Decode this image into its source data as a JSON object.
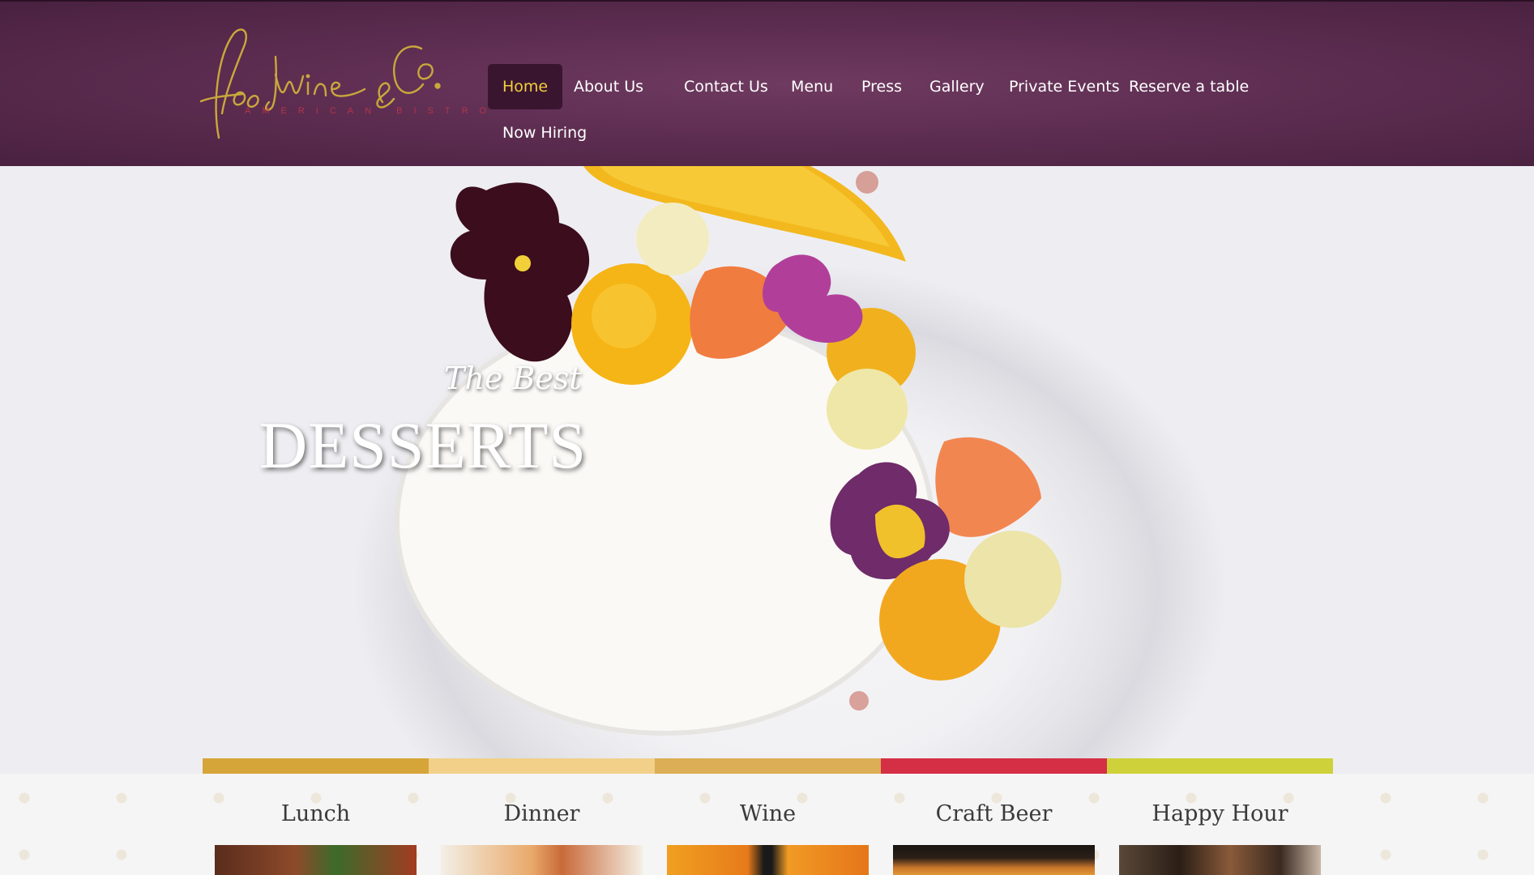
{
  "brand": {
    "logo_script": "food Wine & Co.",
    "tagline": "AMERICAN BISTRO",
    "logo_color": "#c9a83c",
    "tagline_color": "#b3344b"
  },
  "nav": {
    "items": [
      {
        "label": "Home",
        "active": true
      },
      {
        "label": "About Us"
      },
      {
        "label": "Contact Us"
      },
      {
        "label": "Menu"
      },
      {
        "label": "Press"
      },
      {
        "label": "Gallery"
      },
      {
        "label": "Private Events"
      },
      {
        "label": "Reserve a table"
      },
      {
        "label": "Now Hiring"
      }
    ],
    "active_color": "#f3cf3c"
  },
  "hero": {
    "subtitle": "The Best",
    "title": "DESSERTS",
    "image": "dessert-plate-with-edible-flowers"
  },
  "strip": {
    "colors": [
      "#d6a53a",
      "#f2d08a",
      "#dcae55",
      "#d42f45",
      "#cfd13a"
    ]
  },
  "categories": {
    "items": [
      {
        "label": "Lunch"
      },
      {
        "label": "Dinner"
      },
      {
        "label": "Wine"
      },
      {
        "label": "Craft Beer"
      },
      {
        "label": "Happy Hour"
      }
    ]
  }
}
